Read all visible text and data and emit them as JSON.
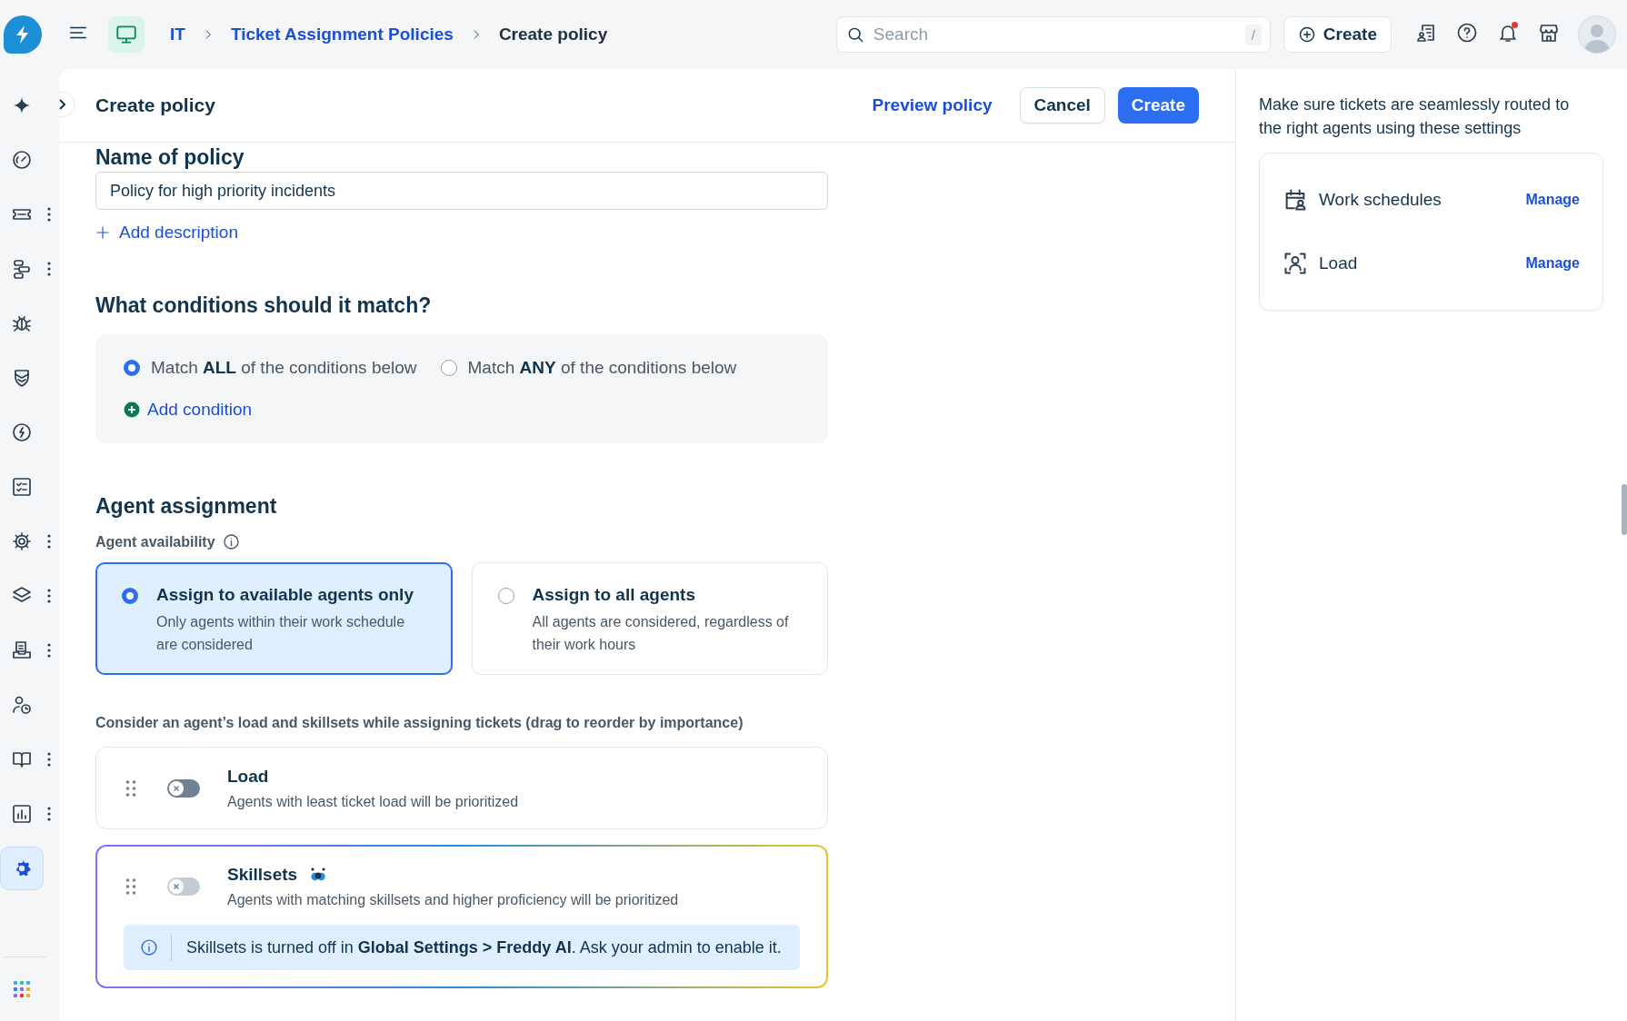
{
  "topbar": {
    "breadcrumbs": [
      {
        "label": "IT",
        "kind": "link"
      },
      {
        "label": "Ticket Assignment Policies",
        "kind": "link"
      },
      {
        "label": "Create policy",
        "kind": "current"
      }
    ],
    "search": {
      "placeholder": "Search",
      "shortcut": "/"
    },
    "create_button": "Create",
    "notifications_unread": true
  },
  "rail": {
    "items": [
      {
        "menu": false,
        "selected": false
      },
      {
        "menu": false,
        "selected": false
      },
      {
        "menu": true,
        "selected": false
      },
      {
        "menu": true,
        "selected": false
      },
      {
        "menu": false,
        "selected": false
      },
      {
        "menu": false,
        "selected": false
      },
      {
        "menu": false,
        "selected": false
      },
      {
        "menu": false,
        "selected": false
      },
      {
        "menu": true,
        "selected": false
      },
      {
        "menu": true,
        "selected": false
      },
      {
        "menu": true,
        "selected": false
      },
      {
        "menu": false,
        "selected": false
      },
      {
        "menu": true,
        "selected": false
      },
      {
        "menu": true,
        "selected": false
      },
      {
        "menu": false,
        "selected": true
      }
    ]
  },
  "header": {
    "title": "Create policy",
    "actions": [
      {
        "label": "Preview policy",
        "kind": "link"
      },
      {
        "label": "Cancel",
        "kind": "secondary"
      },
      {
        "label": "Create",
        "kind": "primary"
      }
    ]
  },
  "form": {
    "name_field": {
      "label": "Name of policy",
      "value": "Policy for high priority incidents"
    },
    "add_description": "Add description",
    "conditions": {
      "title": "What conditions should it match?",
      "options": [
        {
          "label": "Match **ALL** of the conditions below",
          "selected": true
        },
        {
          "label": "Match **ANY** of the conditions below",
          "selected": false
        }
      ],
      "add_condition": "Add condition"
    },
    "assignment": {
      "title": "Agent assignment",
      "availability_label": "Agent availability",
      "availability_options": [
        {
          "title": "Assign to available agents only",
          "description": "Only agents within their work schedule are considered",
          "selected": true
        },
        {
          "title": "Assign to all agents",
          "description": "All agents are considered, regardless of their work hours",
          "selected": false
        }
      ],
      "factors_label": "Consider an agent’s load and skillsets while assigning tickets (drag to reorder by importance)",
      "factors": [
        {
          "title": "Load",
          "description": "Agents with least ticket load will be prioritized",
          "on": false,
          "disabled": false,
          "ai": false
        },
        {
          "title": "Skillsets",
          "description": "Agents with matching skillsets and higher proficiency will be prioritized",
          "on": false,
          "disabled": true,
          "ai": true,
          "notice": "Skillsets is turned off in **Global Settings > Freddy AI**. Ask your admin to enable it."
        }
      ]
    }
  },
  "side_panel": {
    "intro": "Make sure tickets are seamlessly routed to the right agents using these settings",
    "settings": [
      {
        "label": "Work schedules",
        "action": "Manage"
      },
      {
        "label": "Load",
        "action": "Manage"
      }
    ]
  }
}
